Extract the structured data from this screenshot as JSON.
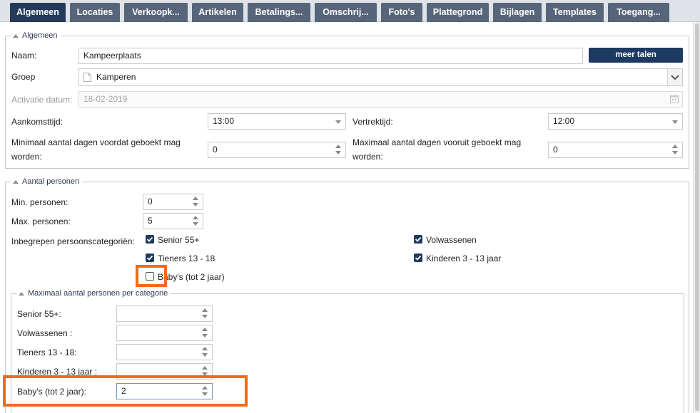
{
  "tabs": [
    {
      "label": "Algemeen",
      "active": true
    },
    {
      "label": "Locaties",
      "active": false
    },
    {
      "label": "Verkoopk...",
      "active": false
    },
    {
      "label": "Artikelen",
      "active": false
    },
    {
      "label": "Betalings...",
      "active": false
    },
    {
      "label": "Omschrij...",
      "active": false
    },
    {
      "label": "Foto's",
      "active": false
    },
    {
      "label": "Plattegrond",
      "active": false
    },
    {
      "label": "Bijlagen",
      "active": false
    },
    {
      "label": "Templates",
      "active": false
    },
    {
      "label": "Toegang...",
      "active": false
    }
  ],
  "general": {
    "legend": "Algemeen",
    "name_label": "Naam:",
    "name_value": "Kampeerplaats",
    "more_languages_button": "meer talen",
    "group_label": "Groep",
    "group_value": "Kamperen",
    "activation_label": "Activatie datum:",
    "activation_value": "18-02-2019",
    "arrival_label": "Aankomsttijd:",
    "arrival_value": "13:00",
    "departure_label": "Vertrektijd:",
    "departure_value": "12:00",
    "min_days_label": "Minimaal aantal dagen voordat geboekt mag worden:",
    "min_days_value": "0",
    "max_days_label": "Maximaal aantal dagen vooruit geboekt mag worden:",
    "max_days_value": "0"
  },
  "persons": {
    "legend": "Aantal personen",
    "min_label": "Min. personen:",
    "min_value": "0",
    "max_label": "Max. personen:",
    "max_value": "5",
    "categories_label": "Inbegrepen persoonscategoriën:",
    "categories": [
      {
        "label": "Senior 55+",
        "checked": true
      },
      {
        "label": "Volwassenen",
        "checked": true
      },
      {
        "label": "Tieners 13 - 18",
        "checked": true
      },
      {
        "label": "Kinderen 3 - 13 jaar",
        "checked": true
      },
      {
        "label": "Baby's (tot 2 jaar)",
        "checked": false
      }
    ]
  },
  "max_per_category": {
    "legend": "Maximaal aantal personen per categorie",
    "rows": [
      {
        "label": "Senior 55+:",
        "value": ""
      },
      {
        "label": "Volwassenen :",
        "value": ""
      },
      {
        "label": "Tieners 13 - 18:",
        "value": ""
      },
      {
        "label": "Kinderen 3 - 13 jaar :",
        "value": ""
      },
      {
        "label": "Baby's (tot 2 jaar):",
        "value": "2"
      }
    ]
  },
  "colors": {
    "tab_active": "#233a5b",
    "tab_inactive": "#56657a",
    "button": "#1d3a63",
    "highlight": "#ef6c15"
  }
}
